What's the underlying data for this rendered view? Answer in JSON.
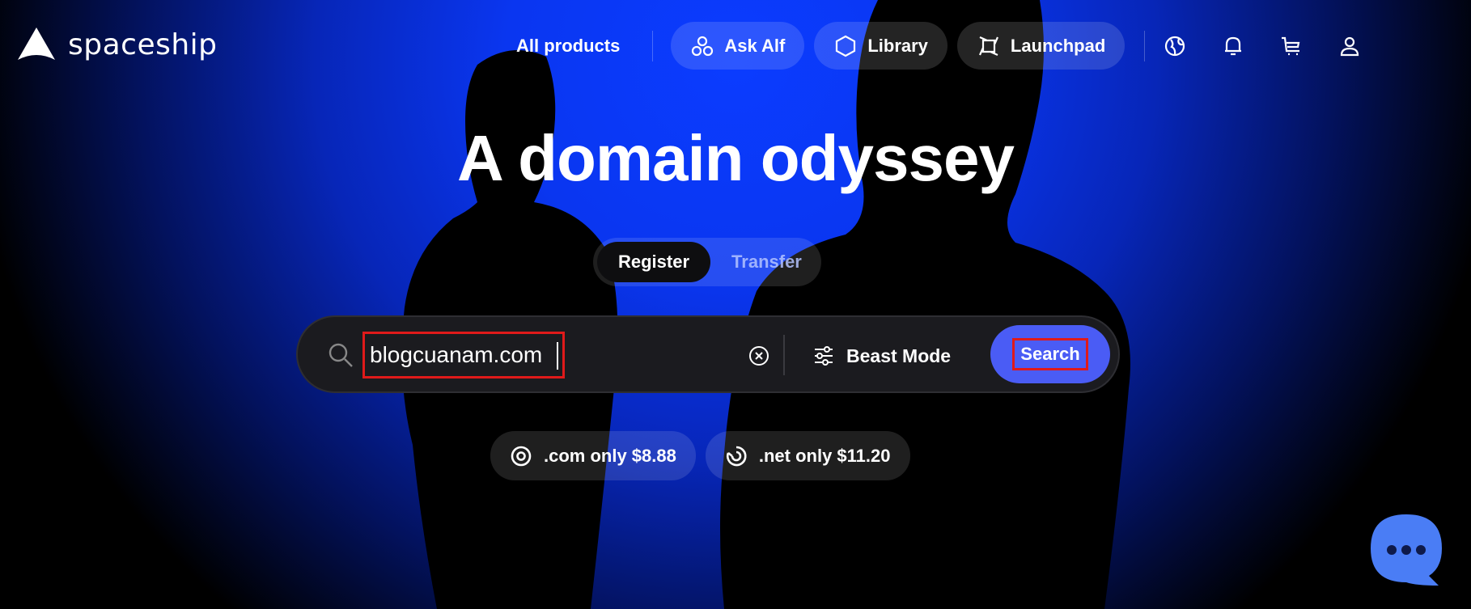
{
  "brand": {
    "name": "spaceship"
  },
  "nav": {
    "all_products": "All products",
    "ask_alf": "Ask Alf",
    "library": "Library",
    "launchpad": "Launchpad"
  },
  "hero": {
    "title": "A domain odyssey",
    "toggle": {
      "register": "Register",
      "transfer": "Transfer",
      "active": "Register"
    }
  },
  "search": {
    "value": "blogcuanam.com",
    "beast_mode": "Beast Mode",
    "button": "Search"
  },
  "promos": [
    {
      "label": ".com only $8.88"
    },
    {
      "label": ".net only $11.20"
    }
  ],
  "colors": {
    "accent": "#4a5cf5",
    "hero_blue": "#0b3cff",
    "highlight": "#e01a1a"
  },
  "icons": [
    "spaceship-logo-icon",
    "ask-alf-icon",
    "library-hexagon-icon",
    "launchpad-icon",
    "globe-icon",
    "bell-icon",
    "cart-icon",
    "user-icon",
    "search-icon",
    "clear-icon",
    "sliders-icon",
    "com-icon",
    "net-icon",
    "chat-icon"
  ]
}
